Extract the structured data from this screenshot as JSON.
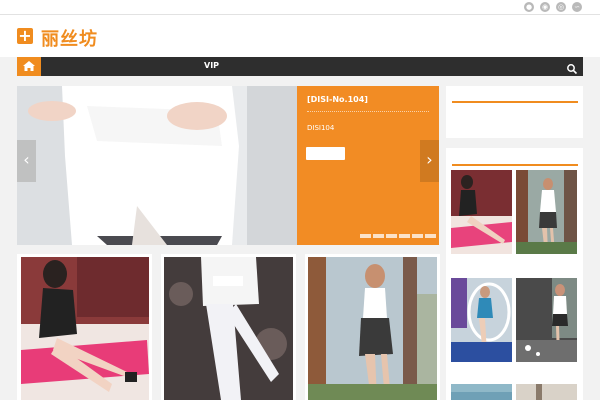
{
  "site": {
    "title": "丽丝坊",
    "logo_icon": "plus-icon"
  },
  "topbar": {
    "icons": [
      "qq-icon",
      "weibo-icon",
      "wechat-icon",
      "rss-icon"
    ]
  },
  "nav": {
    "home_icon": "home-icon",
    "items": [
      {
        "label": "VIP"
      }
    ],
    "search_icon": "search-icon"
  },
  "slider": {
    "title": "[DISI-No.104]",
    "description": "DISI104",
    "button_label": "",
    "dots": 6,
    "prev_arrow": "‹",
    "next_arrow": "›"
  },
  "colors": {
    "accent": "#f08c1f",
    "nav_bg": "#2e2e2e",
    "slide_panel": "#f28c24"
  }
}
